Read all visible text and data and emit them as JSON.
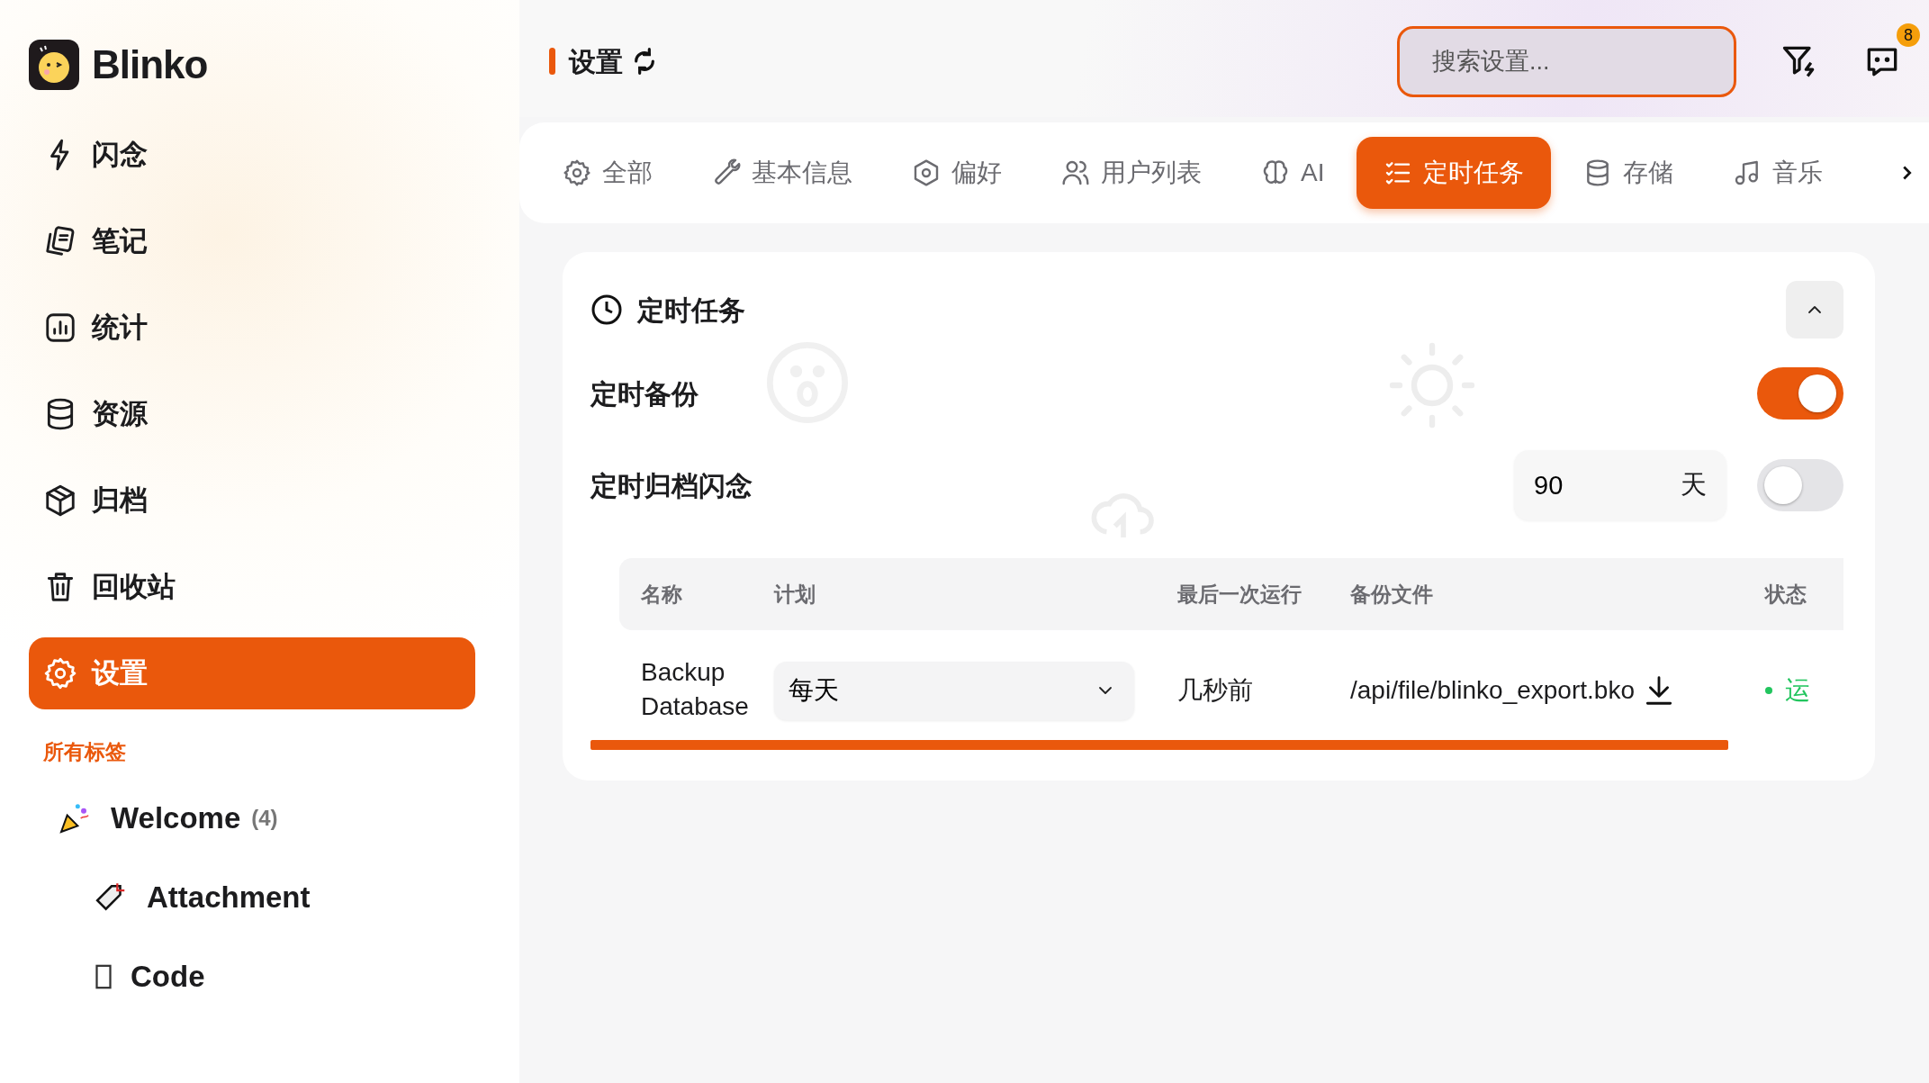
{
  "app": {
    "name": "Blinko"
  },
  "nav": [
    {
      "label": "闪念",
      "selected": false
    },
    {
      "label": "笔记",
      "selected": false
    },
    {
      "label": "统计",
      "selected": false
    },
    {
      "label": "资源",
      "selected": false
    },
    {
      "label": "归档",
      "selected": false
    },
    {
      "label": "回收站",
      "selected": false
    },
    {
      "label": "设置",
      "selected": true
    }
  ],
  "tags_heading": "所有标签",
  "tags": [
    {
      "label": "Welcome",
      "count": "(4)",
      "children": [
        {
          "label": "Attachment"
        },
        {
          "label": "Code"
        }
      ]
    }
  ],
  "header": {
    "title": "设置",
    "search": {
      "placeholder": "搜索设置..."
    },
    "notification_count": "8"
  },
  "tabs": [
    {
      "label": "全部",
      "selected": false
    },
    {
      "label": "基本信息",
      "selected": false
    },
    {
      "label": "偏好",
      "selected": false
    },
    {
      "label": "用户列表",
      "selected": false
    },
    {
      "label": "AI",
      "selected": false
    },
    {
      "label": "定时任务",
      "selected": true
    },
    {
      "label": "存储",
      "selected": false
    },
    {
      "label": "音乐",
      "selected": false
    }
  ],
  "panel": {
    "title": "定时任务",
    "expanded": true,
    "settings": [
      {
        "label": "定时备份",
        "on": true
      },
      {
        "label": "定时归档闪念",
        "on": false,
        "input": {
          "value": "90",
          "unit": "天"
        }
      }
    ],
    "table": {
      "columns": [
        "名称",
        "计划",
        "最后一次运行",
        "备份文件",
        "状态"
      ],
      "rows": [
        {
          "name": "Backup Database",
          "schedule": "每天",
          "last_run": "几秒前",
          "file": "/api/file/blinko_export.bko",
          "status": "运"
        }
      ]
    }
  }
}
